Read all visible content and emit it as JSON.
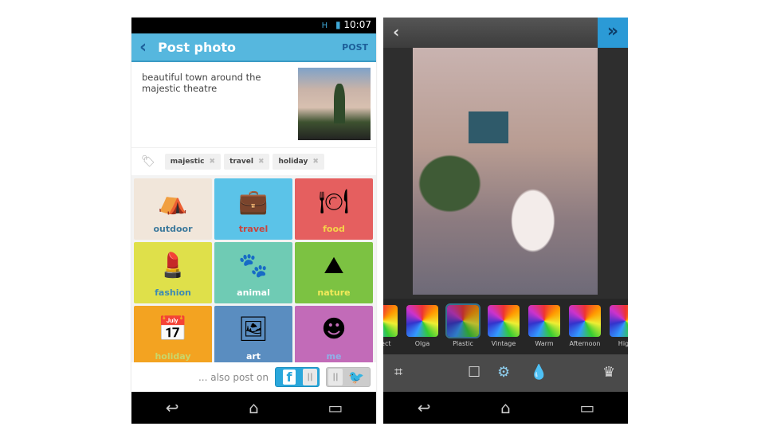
{
  "left": {
    "status": {
      "time": "10:07",
      "signal": "H"
    },
    "appbar": {
      "back": "‹",
      "title": "Post photo",
      "post": "POST"
    },
    "caption": "beautiful town around the majestic theatre",
    "tags": [
      "majestic",
      "travel",
      "holiday"
    ],
    "remove_glyph": "✖",
    "categories": [
      {
        "label": "outdoor",
        "bg": "#f1e6da",
        "fg": "#3d7a9c",
        "icon": "tent-icon",
        "glyph": "⛺"
      },
      {
        "label": "travel",
        "bg": "#5bc3e8",
        "fg": "#c8453e",
        "icon": "suitcase-icon",
        "glyph": "💼"
      },
      {
        "label": "food",
        "bg": "#e55f5f",
        "fg": "#f6d24a",
        "icon": "plate-cutlery-icon",
        "glyph": "🍽"
      },
      {
        "label": "fashion",
        "bg": "#dfe04a",
        "fg": "#3d8bb3",
        "icon": "lipstick-icon",
        "glyph": "💄"
      },
      {
        "label": "animal",
        "bg": "#6fcbb4",
        "fg": "#ffffff",
        "icon": "paw-icon",
        "glyph": "🐾"
      },
      {
        "label": "nature",
        "bg": "#7cc242",
        "fg": "#f3ea5a",
        "icon": "mountain-icon",
        "glyph": "⛰"
      },
      {
        "label": "holiday",
        "bg": "#f3a321",
        "fg": "#c9d66a",
        "icon": "calendar-icon",
        "glyph": "📅"
      },
      {
        "label": "art",
        "bg": "#5a8dc0",
        "fg": "#ffffff",
        "icon": "easel-icon",
        "glyph": "🖼"
      },
      {
        "label": "me",
        "bg": "#c26bb8",
        "fg": "#8fb0e8",
        "icon": "smiley-icon",
        "glyph": "☻"
      }
    ],
    "also_post": "... also post on",
    "facebook": "f",
    "twitter": "🐦",
    "handle": "||"
  },
  "right": {
    "back": "‹",
    "next": "»",
    "filters": [
      {
        "label": "Effect"
      },
      {
        "label": "Olga"
      },
      {
        "label": "Plastic",
        "selected": true
      },
      {
        "label": "Vintage"
      },
      {
        "label": "Warm"
      },
      {
        "label": "Afternoon"
      },
      {
        "label": "High"
      }
    ]
  },
  "nav": {
    "back": "↩",
    "home": "⌂",
    "recents": "▭"
  }
}
